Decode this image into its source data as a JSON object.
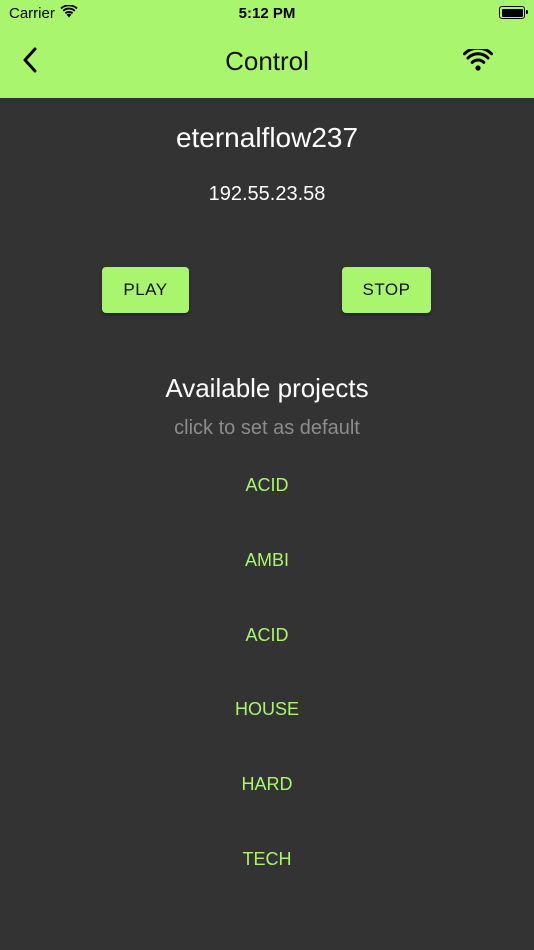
{
  "status_bar": {
    "carrier": "Carrier",
    "time": "5:12 PM"
  },
  "nav": {
    "title": "Control",
    "back_icon": "chevron-left-icon",
    "right_icon": "wifi-icon"
  },
  "device": {
    "name": "eternalflow237",
    "ip": "192.55.23.58"
  },
  "controls": {
    "play_label": "PLAY",
    "stop_label": "STOP"
  },
  "projects": {
    "title": "Available projects",
    "hint": "click to set as default",
    "items": [
      "ACID",
      "AMBI",
      "ACID",
      "HOUSE",
      "HARD",
      "TECH"
    ]
  },
  "colors": {
    "accent": "#a9f56e",
    "background": "#333333",
    "hint_text": "#8c8c8c"
  }
}
